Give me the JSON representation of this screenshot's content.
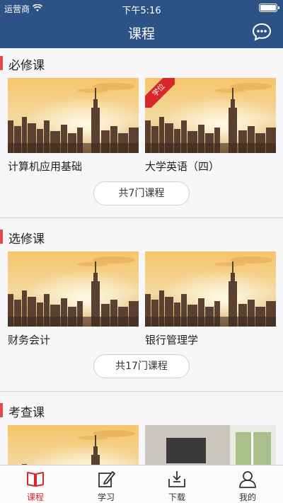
{
  "status": {
    "carrier": "运营商",
    "time": "下午5:16"
  },
  "nav": {
    "title": "课程"
  },
  "sections": [
    {
      "title": "必修课",
      "courses": [
        {
          "title": "计算机应用基础"
        },
        {
          "title": "大学英语（四）",
          "badge": "学位"
        }
      ],
      "more": "共7门课程"
    },
    {
      "title": "选修课",
      "courses": [
        {
          "title": "财务会计"
        },
        {
          "title": "银行管理学"
        }
      ],
      "more": "共17门课程"
    },
    {
      "title": "考查课",
      "courses": [
        {
          "title": ""
        },
        {
          "title": ""
        }
      ]
    }
  ],
  "tabs": [
    {
      "label": "课程",
      "icon": "book-icon",
      "active": true
    },
    {
      "label": "学习",
      "icon": "edit-icon",
      "active": false
    },
    {
      "label": "下载",
      "icon": "download-icon",
      "active": false
    },
    {
      "label": "我的",
      "icon": "person-icon",
      "active": false
    }
  ],
  "colors": {
    "nav": "#2c5286",
    "accent": "#e34b4b",
    "active": "#d9262b"
  }
}
